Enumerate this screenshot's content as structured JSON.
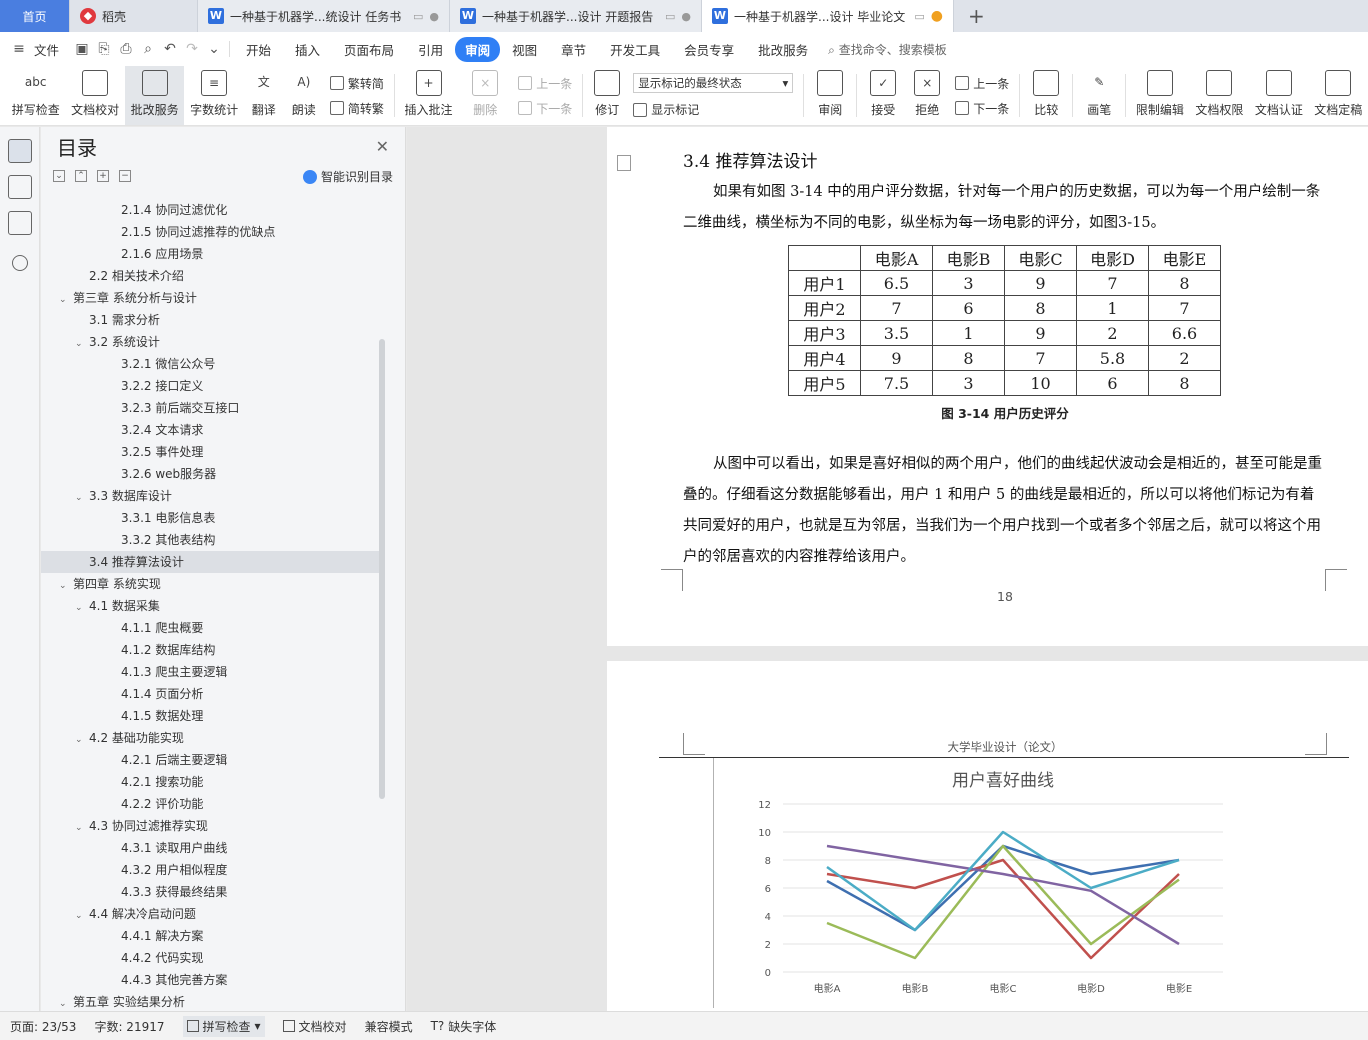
{
  "tabs": {
    "home": "首页",
    "daoke": "稻壳",
    "docs": [
      {
        "label": "一种基于机器学...统设计 任务书",
        "active": false
      },
      {
        "label": "一种基于机器学...设计 开题报告",
        "active": false
      },
      {
        "label": "一种基于机器学...设计 毕业论文",
        "active": true
      }
    ],
    "new_tab": "+"
  },
  "menubar": {
    "file": "文件",
    "items": [
      "开始",
      "插入",
      "页面布局",
      "引用",
      "审阅",
      "视图",
      "章节",
      "开发工具",
      "会员专享",
      "批改服务"
    ],
    "active": "审阅",
    "search": "查找命令、搜索模板"
  },
  "ribbon": {
    "spell": "拼写检查",
    "doc_check": "文档校对",
    "review_service": "批改服务",
    "word_count": "字数统计",
    "translate": "翻译",
    "read_aloud": "朗读",
    "to_trad": "繁转简",
    "to_simp": "简转繁",
    "insert_comment": "插入批注",
    "delete": "删除",
    "prev_comment": "上一条",
    "next_comment": "下一条",
    "track_changes": "修订",
    "markup_select": "显示标记的最终状态",
    "show_markup": "显示标记",
    "review": "审阅",
    "accept": "接受",
    "reject": "拒绝",
    "prev_change": "上一条",
    "next_change": "下一条",
    "compare": "比较",
    "pen": "画笔",
    "restrict": "限制编辑",
    "doc_rights": "文档权限",
    "doc_cert": "文档认证",
    "doc_final": "文档定稿"
  },
  "toc": {
    "title": "目录",
    "smart": "智能识别目录",
    "items": [
      {
        "text": "2.1.4 协同过滤优化",
        "level": 3,
        "arrow": ""
      },
      {
        "text": "2.1.5 协同过滤推荐的优缺点",
        "level": 3,
        "arrow": ""
      },
      {
        "text": "2.1.6 应用场景",
        "level": 3,
        "arrow": ""
      },
      {
        "text": "2.2 相关技术介绍",
        "level": 2,
        "arrow": ""
      },
      {
        "text": "第三章 系统分析与设计",
        "level": 1,
        "arrow": "⌄"
      },
      {
        "text": "3.1 需求分析",
        "level": 2,
        "arrow": ""
      },
      {
        "text": "3.2 系统设计",
        "level": 2,
        "arrow": "⌄"
      },
      {
        "text": "3.2.1 微信公众号",
        "level": 3,
        "arrow": ""
      },
      {
        "text": "3.2.2 接口定义",
        "level": 3,
        "arrow": ""
      },
      {
        "text": "3.2.3 前后端交互接口",
        "level": 3,
        "arrow": ""
      },
      {
        "text": "3.2.4 文本请求",
        "level": 3,
        "arrow": ""
      },
      {
        "text": "3.2.5 事件处理",
        "level": 3,
        "arrow": ""
      },
      {
        "text": "3.2.6 web服务器",
        "level": 3,
        "arrow": ""
      },
      {
        "text": "3.3 数据库设计",
        "level": 2,
        "arrow": "⌄"
      },
      {
        "text": "3.3.1 电影信息表",
        "level": 3,
        "arrow": ""
      },
      {
        "text": "3.3.2 其他表结构",
        "level": 3,
        "arrow": ""
      },
      {
        "text": "3.4 推荐算法设计",
        "level": 2,
        "arrow": "",
        "selected": true
      },
      {
        "text": "第四章 系统实现",
        "level": 1,
        "arrow": "⌄"
      },
      {
        "text": "4.1 数据采集",
        "level": 2,
        "arrow": "⌄"
      },
      {
        "text": "4.1.1 爬虫概要",
        "level": 3,
        "arrow": ""
      },
      {
        "text": "4.1.2 数据库结构",
        "level": 3,
        "arrow": ""
      },
      {
        "text": "4.1.3 爬虫主要逻辑",
        "level": 3,
        "arrow": ""
      },
      {
        "text": "4.1.4 页面分析",
        "level": 3,
        "arrow": ""
      },
      {
        "text": "4.1.5 数据处理",
        "level": 3,
        "arrow": ""
      },
      {
        "text": "4.2 基础功能实现",
        "level": 2,
        "arrow": "⌄"
      },
      {
        "text": "4.2.1 后端主要逻辑",
        "level": 3,
        "arrow": ""
      },
      {
        "text": "4.2.1 搜索功能",
        "level": 3,
        "arrow": ""
      },
      {
        "text": "4.2.2 评价功能",
        "level": 3,
        "arrow": ""
      },
      {
        "text": "4.3 协同过滤推荐实现",
        "level": 2,
        "arrow": "⌄"
      },
      {
        "text": "4.3.1 读取用户曲线",
        "level": 3,
        "arrow": ""
      },
      {
        "text": "4.3.2 用户相似程度",
        "level": 3,
        "arrow": ""
      },
      {
        "text": "4.3.3 获得最终结果",
        "level": 3,
        "arrow": ""
      },
      {
        "text": "4.4 解决冷启动问题",
        "level": 2,
        "arrow": "⌄"
      },
      {
        "text": "4.4.1 解决方案",
        "level": 3,
        "arrow": ""
      },
      {
        "text": "4.4.2 代码实现",
        "level": 3,
        "arrow": ""
      },
      {
        "text": "4.4.3 其他完善方案",
        "level": 3,
        "arrow": ""
      },
      {
        "text": "第五章 实验结果分析",
        "level": 1,
        "arrow": "⌄"
      }
    ]
  },
  "doc": {
    "section_heading": "3.4 推荐算法设计",
    "para1": "如果有如图 3-14 中的用户评分数据，针对每一个用户的历史数据，可以为每一个用户绘制一条二维曲线，横坐标为不同的电影，纵坐标为每一场电影的评分，如图3-15。",
    "table": {
      "header": [
        "",
        "电影A",
        "电影B",
        "电影C",
        "电影D",
        "电影E"
      ],
      "rows": [
        [
          "用户1",
          "6.5",
          "3",
          "9",
          "7",
          "8"
        ],
        [
          "用户2",
          "7",
          "6",
          "8",
          "1",
          "7"
        ],
        [
          "用户3",
          "3.5",
          "1",
          "9",
          "2",
          "6.6"
        ],
        [
          "用户4",
          "9",
          "8",
          "7",
          "5.8",
          "2"
        ],
        [
          "用户5",
          "7.5",
          "3",
          "10",
          "6",
          "8"
        ]
      ]
    },
    "table_caption": "图 3-14 用户历史评分",
    "para2": "从图中可以看出，如果是喜好相似的两个用户，他们的曲线起伏波动会是相近的，甚至可能是重叠的。仔细看这分数据能够看出，用户 1 和用户 5 的曲线是最相近的，所以可以将他们标记为有着共同爱好的用户，也就是互为邻居，当我们为一个用户找到一个或者多个邻居之后，就可以将这个用户的邻居喜欢的内容推荐给该用户。",
    "page_number": "18",
    "page2_header": "大学毕业设计（论文）"
  },
  "chart_data": {
    "type": "line",
    "title": "用户喜好曲线",
    "categories": [
      "电影A",
      "电影B",
      "电影C",
      "电影D",
      "电影E"
    ],
    "ylim": [
      0,
      12
    ],
    "yticks": [
      0,
      2,
      4,
      6,
      8,
      10,
      12
    ],
    "grid": true,
    "series": [
      {
        "values": [
          6.5,
          3,
          9,
          7,
          8
        ],
        "color": "#3e6fb0"
      },
      {
        "values": [
          7,
          6,
          8,
          1,
          7
        ],
        "color": "#c0504d"
      },
      {
        "values": [
          3.5,
          1,
          9,
          2,
          6.6
        ],
        "color": "#9bbb59"
      },
      {
        "values": [
          9,
          8,
          7,
          5.8,
          2
        ],
        "color": "#8064a2"
      },
      {
        "values": [
          7.5,
          3,
          10,
          6,
          8
        ],
        "color": "#4bacc6"
      }
    ]
  },
  "status": {
    "page": "页面: 23/53",
    "words": "字数: 21917",
    "spell": "拼写检查",
    "doc_check": "文档校对",
    "compat": "兼容模式",
    "missing_font": "缺失字体"
  }
}
